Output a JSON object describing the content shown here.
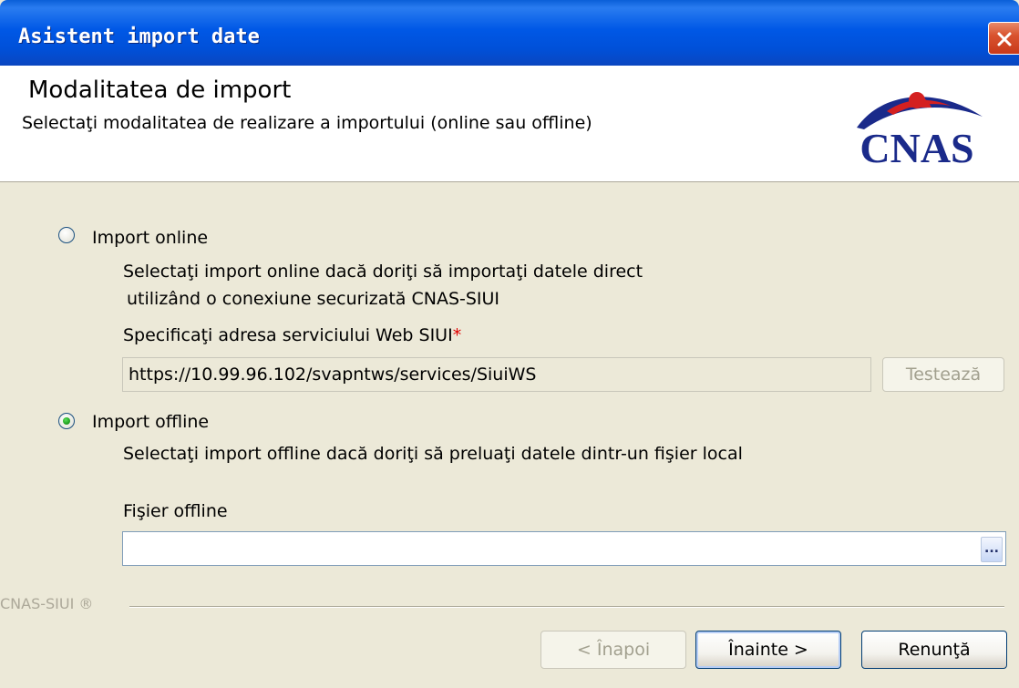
{
  "window": {
    "title": "Asistent import date"
  },
  "header": {
    "heading": "Modalitatea de import",
    "subtitle": "Selectaţi modalitatea de realizare a importului (online sau offline)",
    "logo_text": "CNAS"
  },
  "online": {
    "label": "Import online",
    "selected": false,
    "description_line1": "Selectaţi import online dacă doriţi să importaţi datele direct",
    "description_line2": "utilizând o conexiune securizată CNAS-SIUI",
    "address_label": "Specificaţi adresa serviciului Web SIUI",
    "required_mark": "*",
    "address_value": "https://10.99.96.102/svapntws/services/SiuiWS",
    "test_button": "Testează"
  },
  "offline": {
    "label": "Import offline",
    "selected": true,
    "description": "Selectaţi import offline dacă doriţi să preluaţi datele dintr-un fişier local",
    "file_label": "Fişier offline",
    "file_value": "",
    "browse_button": "..."
  },
  "footer": {
    "brand": "CNAS-SIUI ®",
    "back_button": "< Înapoi",
    "next_button": "Înainte >",
    "cancel_button": "Renunţă"
  },
  "colors": {
    "titlebar": "#0058e6",
    "dialog_bg": "#ece9d8",
    "logo_red": "#d42020",
    "logo_blue": "#1a2a8a"
  }
}
